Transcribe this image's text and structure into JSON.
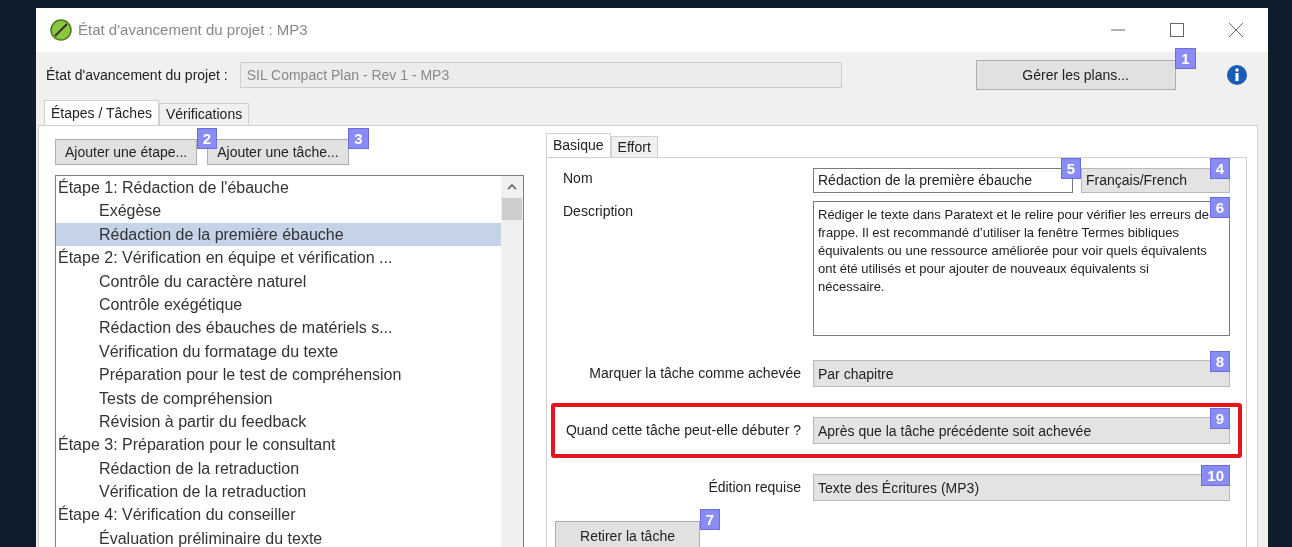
{
  "window": {
    "title": "État d'avancement du projet : MP3"
  },
  "project": {
    "label": "État d'avancement du projet :",
    "value": "SIL Compact Plan - Rev 1 - MP3",
    "manage_button": "Gérer les plans...",
    "manage_badge": "1"
  },
  "tabs": [
    {
      "label": "Étapes / Tâches",
      "selected": true
    },
    {
      "label": "Vérifications",
      "selected": false
    }
  ],
  "buttons": [
    {
      "label": "Ajouter une étape...",
      "badge": "2"
    },
    {
      "label": "Ajouter une tâche...",
      "badge": "3"
    }
  ],
  "tree": [
    {
      "label": "Étape 1: Rédaction de l'ébauche",
      "selected": false,
      "children": [
        {
          "label": "Exégèse",
          "selected": false
        },
        {
          "label": "Rédaction de la première ébauche",
          "selected": true
        }
      ]
    },
    {
      "label": "Étape 2: Vérification en équipe et vérification ...",
      "selected": false,
      "children": [
        {
          "label": "Contrôle du caractère naturel",
          "selected": false
        },
        {
          "label": "Contrôle exégétique",
          "selected": false
        },
        {
          "label": "Rédaction des ébauches de matériels s...",
          "selected": false
        },
        {
          "label": "Vérification du formatage du texte",
          "selected": false
        },
        {
          "label": "Préparation pour le test de compréhension",
          "selected": false
        },
        {
          "label": "Tests de compréhension",
          "selected": false
        },
        {
          "label": "Révision à partir du feedback",
          "selected": false
        }
      ]
    },
    {
      "label": "Étape 3: Préparation pour le consultant",
      "selected": false,
      "children": [
        {
          "label": "Rédaction de la retraduction",
          "selected": false
        },
        {
          "label": "Vérification de la retraduction",
          "selected": false
        }
      ]
    },
    {
      "label": "Étape 4: Vérification du conseiller",
      "selected": false,
      "children": [
        {
          "label": "Évaluation préliminaire du texte",
          "selected": false
        }
      ]
    }
  ],
  "detail_tabs": [
    {
      "label": "Basique",
      "selected": true
    },
    {
      "label": "Effort",
      "selected": false
    }
  ],
  "name": {
    "label": "Nom",
    "value": "Rédaction de la première ébauche",
    "badge": "5",
    "language": "Français/French",
    "language_badge": "4"
  },
  "description": {
    "label": "Description",
    "value": "Rédiger le texte dans Paratext et le relire pour vérifier les erreurs de frappe. Il est recommandé d’utiliser la fenêtre Termes bibliques équivalents ou une ressource améliorée pour voir quels équivalents ont été utilisés et pour ajouter de nouveaux équivalents si nécessaire.",
    "badge": "6"
  },
  "selects": [
    {
      "label": "Marquer la tâche comme achevée",
      "value": "Par chapitre",
      "badge": "8",
      "highlighted": false
    },
    {
      "label": "Quand cette tâche peut-elle débuter ?",
      "value": "Après que la tâche précédente soit achevée",
      "badge": "9",
      "highlighted": true
    },
    {
      "label": "Édition requise",
      "value": "Texte des Écritures (MP3)",
      "badge": "10",
      "highlighted": false
    }
  ],
  "remove_button": {
    "label": "Retirer la tâche",
    "badge": "7"
  }
}
